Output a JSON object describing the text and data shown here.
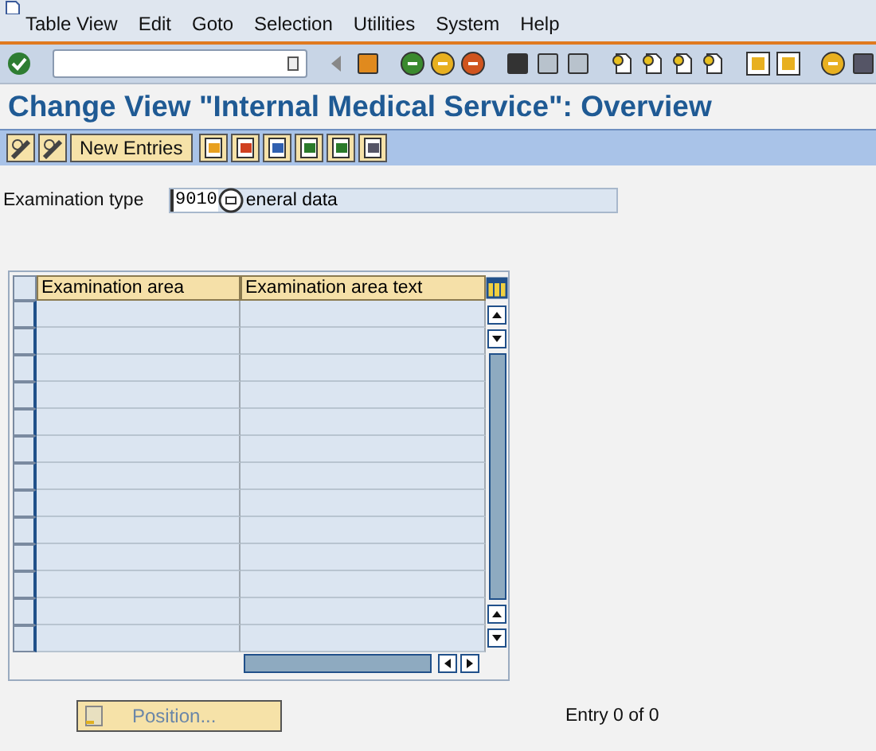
{
  "menu_bar": {
    "items": [
      "Table View",
      "Edit",
      "Goto",
      "Selection",
      "Utilities",
      "System",
      "Help"
    ]
  },
  "title": "Change View \"Internal Medical Service\": Overview",
  "app_toolbar": {
    "new_entries_button": "New Entries"
  },
  "examination_type": {
    "label": "Examination type",
    "value": "9010",
    "description": "eneral data"
  },
  "table": {
    "columns": [
      "Examination area",
      "Examination area text"
    ]
  },
  "position_button": {
    "label": "Position...",
    "disabled": true
  },
  "entry_count": "Entry 0 of 0"
}
